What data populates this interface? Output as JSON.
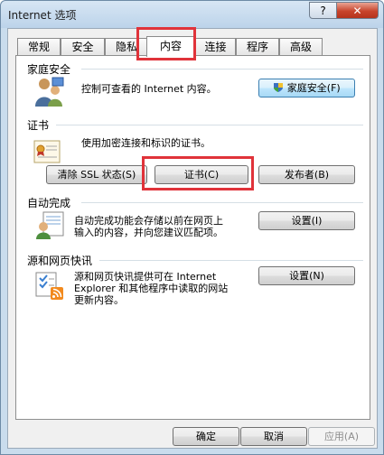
{
  "window": {
    "title": "Internet 选项",
    "help_glyph": "?",
    "close_glyph": "✕"
  },
  "tabs": [
    {
      "label": "常规",
      "active": false
    },
    {
      "label": "安全",
      "active": false
    },
    {
      "label": "隐私",
      "active": false
    },
    {
      "label": "内容",
      "active": true
    },
    {
      "label": "连接",
      "active": false
    },
    {
      "label": "程序",
      "active": false
    },
    {
      "label": "高级",
      "active": false
    }
  ],
  "family_safety": {
    "title": "家庭安全",
    "description": "控制可查看的 Internet 内容。",
    "button": "家庭安全(F)"
  },
  "certificates": {
    "title": "证书",
    "description": "使用加密连接和标识的证书。",
    "clear_ssl_button": "清除 SSL 状态(S)",
    "certificates_button": "证书(C)",
    "publishers_button": "发布者(B)"
  },
  "autocomplete": {
    "title": "自动完成",
    "description_line1": "自动完成功能会存储以前在网页上",
    "description_line2": "输入的内容，并向您建议匹配项。",
    "settings_button": "设置(I)"
  },
  "feeds": {
    "title": "源和网页快讯",
    "description_line1": "源和网页快讯提供可在 Internet",
    "description_line2": "Explorer 和其他程序中读取的网站",
    "description_line3": "更新内容。",
    "settings_button": "设置(N)"
  },
  "footer": {
    "ok": "确定",
    "cancel": "取消",
    "apply": "应用(A)"
  },
  "colors": {
    "highlight": "#e0333a",
    "window_frame": "#c9dced"
  }
}
